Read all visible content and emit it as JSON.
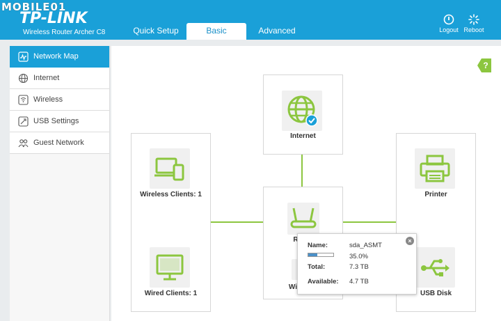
{
  "watermark": "MOBILE01",
  "brand": "TP-LINK",
  "model": "Wireless Router Archer C8",
  "tabs": {
    "quick": "Quick Setup",
    "basic": "Basic",
    "advanced": "Advanced"
  },
  "header_buttons": {
    "logout": "Logout",
    "reboot": "Reboot"
  },
  "sidebar": {
    "items": [
      {
        "label": "Network Map",
        "icon": "network-map-icon"
      },
      {
        "label": "Internet",
        "icon": "globe-icon"
      },
      {
        "label": "Wireless",
        "icon": "wireless-icon"
      },
      {
        "label": "USB Settings",
        "icon": "usb-icon"
      },
      {
        "label": "Guest Network",
        "icon": "guest-network-icon"
      }
    ]
  },
  "help": "?",
  "map": {
    "internet": "Internet",
    "wireless_clients": "Wireless Clients: 1",
    "wired_clients": "Wired Clients: 1",
    "router_partial": "R",
    "wireless_partial": "Wi",
    "printer": "Printer",
    "usb_disk": "USB Disk"
  },
  "popup": {
    "name_label": "Name:",
    "name_value": "sda_ASMT",
    "usage": "35.0%",
    "usage_fraction": 0.35,
    "total_label": "Total:",
    "total_value": "7.3 TB",
    "available_label": "Available:",
    "available_value": "4.7 TB",
    "close": "×"
  },
  "colors": {
    "header": "#1aa0d8",
    "accent_green": "#8cc63f",
    "active_tab_text": "#1a90c8"
  }
}
